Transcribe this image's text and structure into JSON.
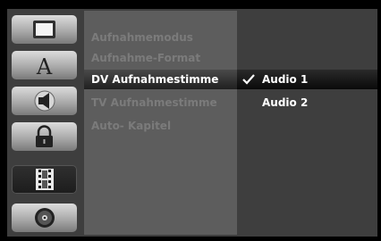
{
  "sidebar": {
    "icons": [
      {
        "name": "tv-screen-icon",
        "active": false
      },
      {
        "name": "language-a-icon",
        "active": false,
        "glyph": "A"
      },
      {
        "name": "speaker-icon",
        "active": false
      },
      {
        "name": "padlock-icon",
        "active": false
      },
      {
        "name": "film-strip-icon",
        "active": true
      },
      {
        "name": "disc-icon",
        "active": false
      }
    ]
  },
  "menu": {
    "items": [
      {
        "label": "Aufnahmemodus",
        "selected": false
      },
      {
        "label": "Aufnahme-Format",
        "selected": false
      },
      {
        "label": "DV Aufnahmestimme",
        "selected": true
      },
      {
        "label": "TV Aufnahmestimme",
        "selected": false
      },
      {
        "label": "Auto- Kapitel",
        "selected": false
      }
    ]
  },
  "submenu": {
    "options": [
      {
        "label": "Audio 1",
        "checked": true
      },
      {
        "label": "Audio 2",
        "checked": false
      }
    ]
  },
  "colors": {
    "background": "#3e3e3e",
    "menu_panel": "#5d5d5d",
    "highlight": "#1c1c1c",
    "disabled_text": "#7b7b7b"
  }
}
